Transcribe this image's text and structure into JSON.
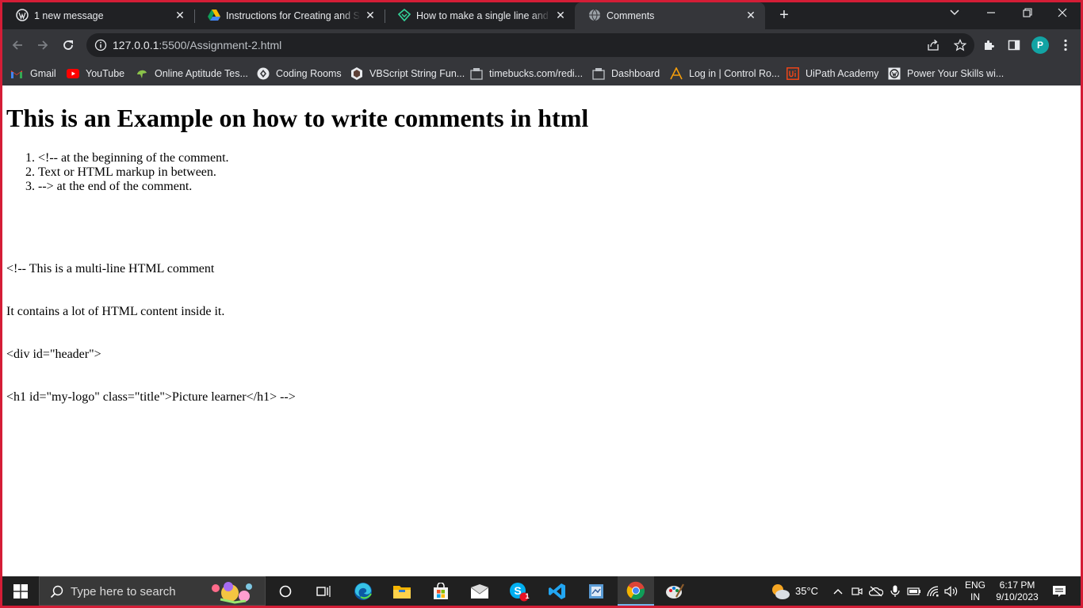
{
  "browser": {
    "tabs": [
      {
        "title": "1 new message",
        "icon": "wordpress-icon",
        "active": false
      },
      {
        "title": "Instructions for Creating and Submitting",
        "icon": "google-drive-icon",
        "active": false
      },
      {
        "title": "How to make a single line and multi-line comment",
        "icon": "diamond-icon",
        "active": false
      },
      {
        "title": "Comments",
        "icon": "globe-icon",
        "active": true
      }
    ],
    "new_tab_label": "+",
    "address": {
      "host": "127.0.0.1",
      "rest": ":5500/Assignment-2.html"
    },
    "profile_initial": "P",
    "colors": {
      "frame": "#d41d36",
      "tabstrip": "#202124",
      "toolbar": "#35363a",
      "avatar": "#12a4a4"
    }
  },
  "bookmarks": [
    {
      "label": "Gmail",
      "icon": "gmail-icon"
    },
    {
      "label": "YouTube",
      "icon": "youtube-icon"
    },
    {
      "label": "Online Aptitude Tes...",
      "icon": "aptitude-icon"
    },
    {
      "label": "Coding Rooms",
      "icon": "coding-rooms-icon"
    },
    {
      "label": "VBScript String Fun...",
      "icon": "vbscript-icon"
    },
    {
      "label": "timebucks.com/redi...",
      "icon": "timebucks-icon"
    },
    {
      "label": "Dashboard",
      "icon": "dashboard-icon"
    },
    {
      "label": "Log in | Control Ro...",
      "icon": "control-room-icon"
    },
    {
      "label": "UiPath Academy",
      "icon": "uipath-icon"
    },
    {
      "label": "Power Your Skills wi...",
      "icon": "power-skills-icon"
    }
  ],
  "page": {
    "heading": "This is an Example on how to write comments in html",
    "steps": [
      {
        "num": "1.",
        "text": "<!-- at the beginning of the comment."
      },
      {
        "num": "2.",
        "text": "Text or HTML markup in between."
      },
      {
        "num": "3.",
        "text": "--> at the end of the comment."
      }
    ],
    "comment_lines": [
      "<!-- This is a multi-line HTML comment",
      "It contains a lot of HTML content inside it.",
      "<div id=\"header\">",
      "<h1 id=\"my-logo\" class=\"title\">Picture learner</h1> -->"
    ]
  },
  "taskbar": {
    "search_placeholder": "Type here to search",
    "weather": "35°C",
    "language": {
      "line1": "ENG",
      "line2": "IN"
    },
    "clock": {
      "time": "6:17 PM",
      "date": "9/10/2023"
    },
    "skype_badge": "1"
  }
}
